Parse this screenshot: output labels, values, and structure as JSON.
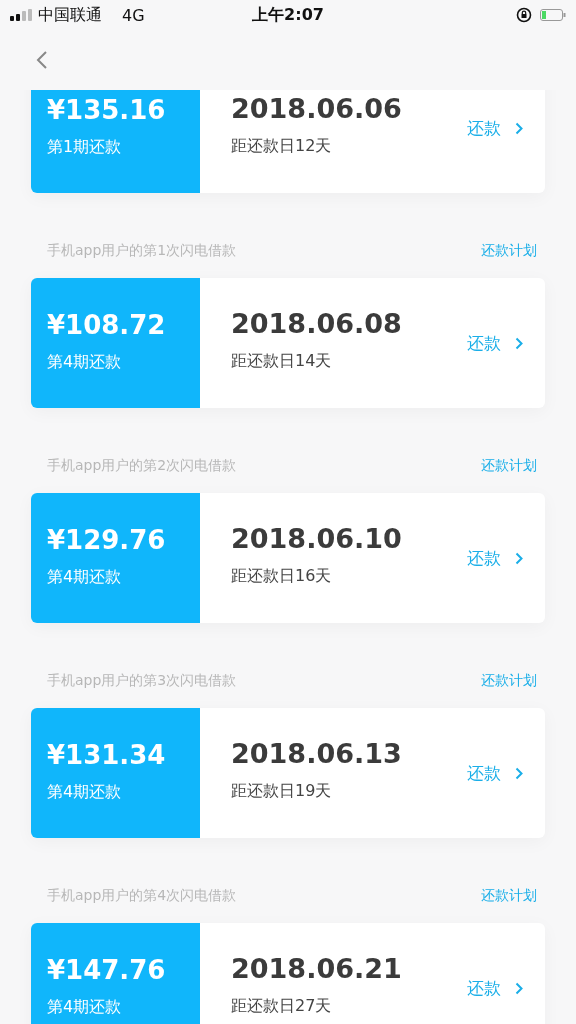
{
  "status_bar": {
    "carrier": "中国联通",
    "network": "4G",
    "time": "上午2:07"
  },
  "repayments": [
    {
      "amount": "¥135.16",
      "period": "第1期还款",
      "date": "2018.06.06",
      "countdown": "距还款日12天",
      "action": "还款"
    },
    {
      "title": "手机app用户的第1次闪电借款",
      "plan_link": "还款计划",
      "amount": "¥108.72",
      "period": "第4期还款",
      "date": "2018.06.08",
      "countdown": "距还款日14天",
      "action": "还款"
    },
    {
      "title": "手机app用户的第2次闪电借款",
      "plan_link": "还款计划",
      "amount": "¥129.76",
      "period": "第4期还款",
      "date": "2018.06.10",
      "countdown": "距还款日16天",
      "action": "还款"
    },
    {
      "title": "手机app用户的第3次闪电借款",
      "plan_link": "还款计划",
      "amount": "¥131.34",
      "period": "第4期还款",
      "date": "2018.06.13",
      "countdown": "距还款日19天",
      "action": "还款"
    },
    {
      "title": "手机app用户的第4次闪电借款",
      "plan_link": "还款计划",
      "amount": "¥147.76",
      "period": "第4期还款",
      "date": "2018.06.21",
      "countdown": "距还款日27天",
      "action": "还款"
    }
  ]
}
